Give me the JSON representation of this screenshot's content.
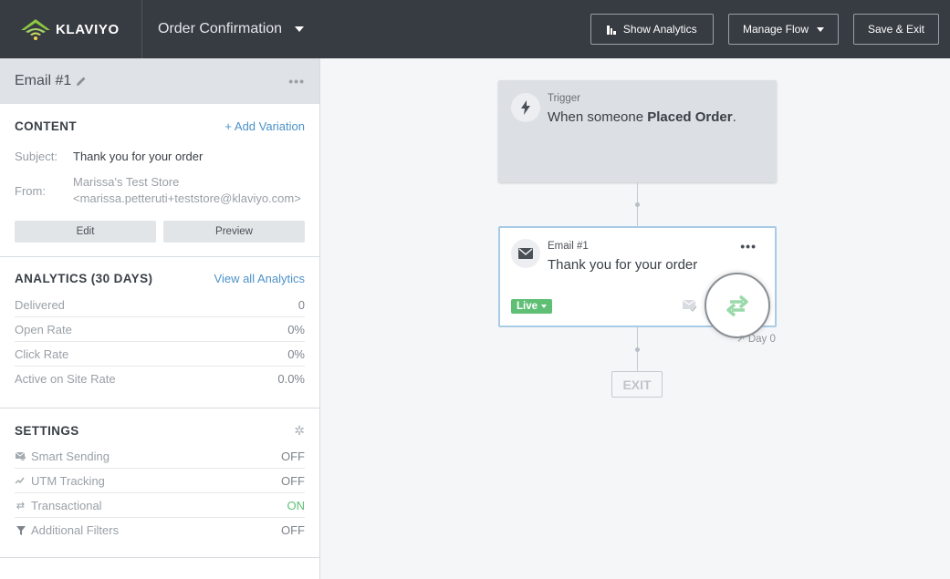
{
  "app": {
    "logo_text": "KLAVIYO",
    "flow_title": "Order Confirmation"
  },
  "toolbar": {
    "show_analytics": "Show Analytics",
    "manage_flow": "Manage Flow",
    "save_exit": "Save & Exit"
  },
  "sidebar": {
    "header_title": "Email #1",
    "content": {
      "title": "CONTENT",
      "add_variation": "+ Add Variation",
      "subject_label": "Subject:",
      "subject_value": "Thank you for your order",
      "from_label": "From:",
      "from_name": "Marissa's Test Store",
      "from_email": "<marissa.petteruti+teststore@klaviyo.com>",
      "edit_label": "Edit",
      "preview_label": "Preview"
    },
    "analytics": {
      "title": "ANALYTICS (30 DAYS)",
      "view_all": "View all Analytics",
      "rows": [
        {
          "label": "Delivered",
          "value": "0"
        },
        {
          "label": "Open Rate",
          "value": "0%"
        },
        {
          "label": "Click Rate",
          "value": "0%"
        },
        {
          "label": "Active on Site Rate",
          "value": "0.0%"
        }
      ]
    },
    "settings": {
      "title": "SETTINGS",
      "rows": [
        {
          "label": "Smart Sending",
          "value": "OFF",
          "icon": "smart-sending-icon"
        },
        {
          "label": "UTM Tracking",
          "value": "OFF",
          "icon": "utm-tracking-icon"
        },
        {
          "label": "Transactional",
          "value": "ON",
          "icon": "transactional-icon"
        },
        {
          "label": "Additional Filters",
          "value": "OFF",
          "icon": "filter-icon"
        }
      ]
    }
  },
  "canvas": {
    "trigger": {
      "label": "Trigger",
      "text_prefix": "When someone ",
      "text_bold": "Placed Order",
      "text_suffix": "."
    },
    "email_node": {
      "label": "Email #1",
      "text": "Thank you for your order",
      "status": "Live",
      "delay": "Day 0"
    },
    "exit_label": "EXIT"
  },
  "colors": {
    "topbar": "#373b42",
    "accent_link": "#4c92c9",
    "live_green": "#5fbf75",
    "on_green": "#5fbf75",
    "node_border": "#a8cbe6"
  }
}
